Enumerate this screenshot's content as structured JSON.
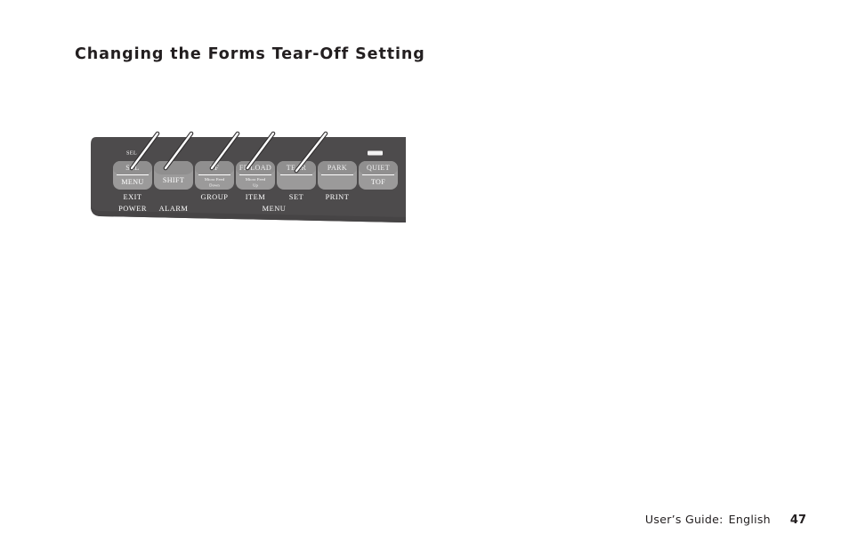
{
  "page": {
    "title": "Changing the Forms Tear-Off Setting"
  },
  "figure": {
    "name": "printer-control-panel",
    "colors": {
      "panel": "#4d4b4c",
      "panel_edge": "#3f3d3e",
      "button": "#9b9a9a",
      "button_top": "#8f8e8e",
      "led": "#f2f2f2",
      "line": "#ffffff",
      "text": "#ffffff"
    },
    "led_indicators": [
      {
        "name": "sel-led",
        "label": "SEL"
      },
      {
        "name": "quiet-led",
        "label": ""
      }
    ],
    "buttons": [
      {
        "name": "sel-menu-button",
        "top_label": "SEL",
        "bottom_label": "MENU",
        "micro_label": "",
        "under_labels": [
          "EXIT",
          "POWER"
        ],
        "callout": true
      },
      {
        "name": "shift-button",
        "top_label": "",
        "bottom_label": "SHIFT",
        "micro_label": "",
        "under_labels": [
          "ALARM"
        ],
        "callout": true
      },
      {
        "name": "lf-microfeed-down-button",
        "top_label": "LF",
        "bottom_label": "",
        "micro_label": "Micro Feed Down",
        "under_labels": [
          "GROUP"
        ],
        "callout": true
      },
      {
        "name": "ff-load-microfeed-up-button",
        "top_label": "FF/LOAD",
        "bottom_label": "",
        "micro_label": "Micro Feed Up",
        "under_labels": [
          "ITEM"
        ],
        "callout": true
      },
      {
        "name": "tear-set-button",
        "top_label": "TEAR",
        "bottom_label": "",
        "micro_label": "",
        "under_labels": [
          "SET"
        ],
        "callout": true
      },
      {
        "name": "park-print-button",
        "top_label": "PARK",
        "bottom_label": "",
        "micro_label": "",
        "under_labels": [
          "PRINT"
        ],
        "callout": false
      },
      {
        "name": "quiet-tof-button",
        "top_label": "QUIET",
        "bottom_label": "TOF",
        "micro_label": "",
        "under_labels": [],
        "callout": false
      }
    ],
    "micro_lines": {
      "lf_line1": "Micro Feed",
      "lf_line2": "Down",
      "ff_line1": "Micro Feed",
      "ff_line2": "Up"
    },
    "group_label": "MENU"
  },
  "footer": {
    "guide": "User’s Guide:",
    "language": "English",
    "page_number": "47"
  }
}
